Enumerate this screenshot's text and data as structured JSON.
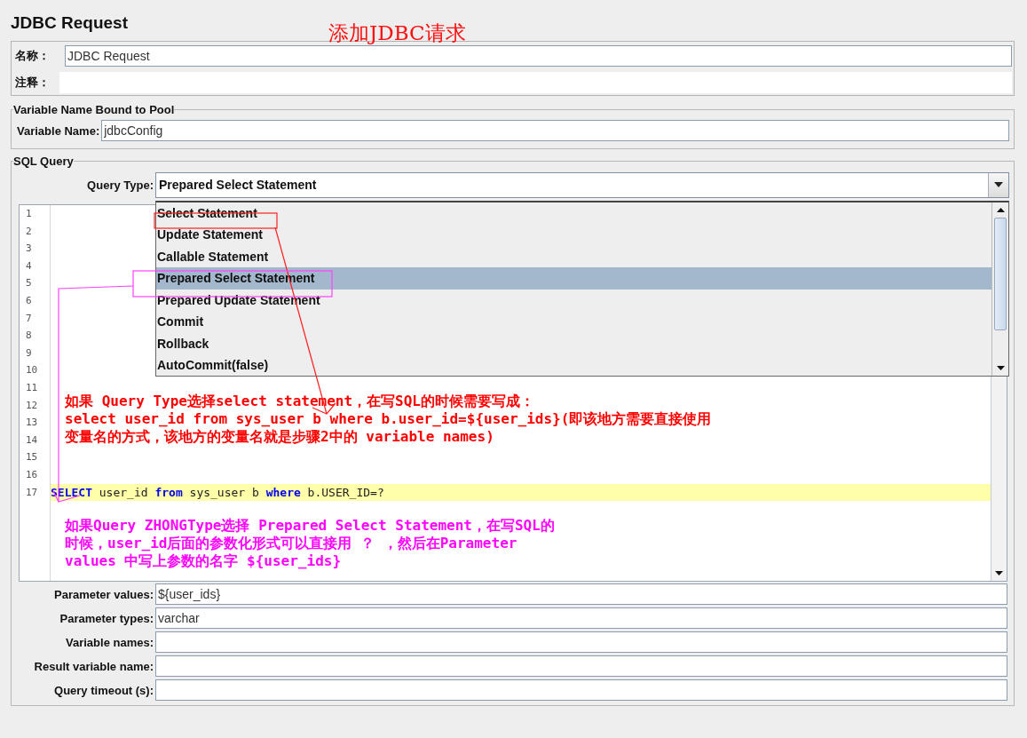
{
  "title": "JDBC Request",
  "title_note": "添加JDBC请求",
  "name_panel": {
    "fields": [
      {
        "label": "名称：",
        "value": "JDBC Request"
      },
      {
        "label": "注释："
      }
    ]
  },
  "pool_group": {
    "title": "Variable Name Bound to Pool",
    "label": "Variable Name:",
    "value": "jdbcConfig"
  },
  "sql_query": {
    "title": "SQL Query",
    "query_type": {
      "label": "Query Type:",
      "value": "Prepared Select Statement",
      "options": [
        {
          "label": "Select Statement",
          "selected": false
        },
        {
          "label": "Update Statement",
          "selected": false
        },
        {
          "label": "Callable Statement",
          "selected": false
        },
        {
          "label": "Prepared Select Statement",
          "selected": true
        },
        {
          "label": "Prepared Update Statement",
          "selected": false
        },
        {
          "label": "Commit",
          "selected": false
        },
        {
          "label": "Rollback",
          "selected": false
        },
        {
          "label": "AutoCommit(false)",
          "selected": false
        }
      ]
    },
    "editor": {
      "line_numbers": [
        "1",
        "2",
        "3",
        "4",
        "5",
        "6",
        "7",
        "8",
        "9",
        "10",
        "11",
        "12",
        "13",
        "14",
        "15",
        "16",
        "17"
      ],
      "code_line": [
        {
          "text": "SELECT",
          "kind": "keyword"
        },
        {
          "text": " user_id ",
          "kind": "plain"
        },
        {
          "text": "from",
          "kind": "keyword"
        },
        {
          "text": " sys_user b ",
          "kind": "plain"
        },
        {
          "text": "where",
          "kind": "keyword"
        },
        {
          "text": " b.USER_ID=?",
          "kind": "plain"
        }
      ],
      "red_note": [
        "如果 Query Type选择select statement，在写SQL的时候需要写成：",
        "select user_id from sys_user b where b.user_id=${user_ids}(即该地方需要直接使用",
        "变量名的方式，该地方的变量名就是步骤2中的 variable names)"
      ],
      "magenta_note": [
        "如果Query ZHONGType选择 Prepared Select Statement，在写SQL的",
        "时候，user_id后面的参数化形式可以直接用 ？ ，然后在Parameter",
        "values 中写上参数的名字 ${user_ids}"
      ]
    },
    "params": [
      {
        "label": "Parameter values:",
        "value": "${user_ids}"
      },
      {
        "label": "Parameter types:",
        "value": "varchar"
      },
      {
        "label": "Variable names:"
      },
      {
        "label": "Result variable name:"
      },
      {
        "label": "Query timeout (s):"
      }
    ]
  }
}
